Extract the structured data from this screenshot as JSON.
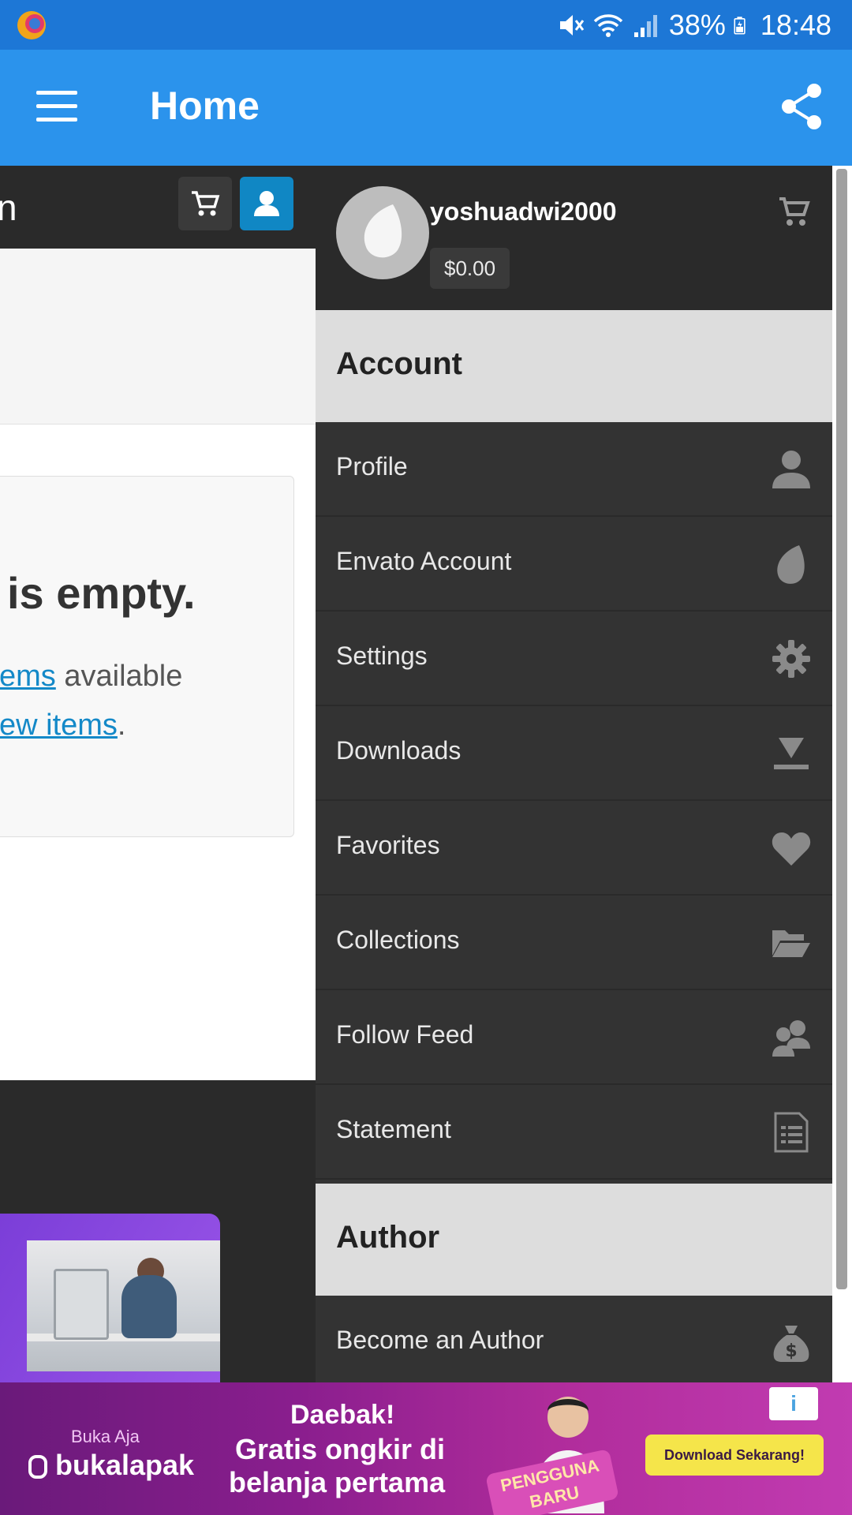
{
  "status_bar": {
    "battery": "38%",
    "time": "18:48",
    "icons": [
      "firefox-focus-icon",
      "mute-icon",
      "wifi-icon",
      "signal-icon",
      "battery-icon"
    ]
  },
  "app_bar": {
    "title": "Home",
    "icons": [
      "menu-icon",
      "share-icon"
    ]
  },
  "background_page": {
    "topbar_text": "n",
    "empty": {
      "heading": "is empty.",
      "line1_link": "ems",
      "line1_rest": " available",
      "line2_link": "ew items",
      "line2_rest": "."
    }
  },
  "drawer": {
    "username": "yoshuadwi2000",
    "balance": "$0.00",
    "sections": {
      "account": "Account",
      "author": "Author"
    },
    "account_items": [
      {
        "label": "Profile",
        "icon": "person-icon"
      },
      {
        "label": "Envato Account",
        "icon": "envato-leaf-icon"
      },
      {
        "label": "Settings",
        "icon": "gear-icon"
      },
      {
        "label": "Downloads",
        "icon": "download-icon"
      },
      {
        "label": "Favorites",
        "icon": "heart-icon"
      },
      {
        "label": "Collections",
        "icon": "folder-open-icon"
      },
      {
        "label": "Follow Feed",
        "icon": "users-icon"
      },
      {
        "label": "Statement",
        "icon": "document-icon"
      }
    ],
    "author_items": [
      {
        "label": "Become an Author",
        "icon": "money-bag-icon"
      }
    ]
  },
  "ad": {
    "brand_small": "Buka Aja",
    "brand": "bukalapak",
    "headline1": "Daebak!",
    "headline2": "Gratis ongkir di",
    "headline3": "belanja pertama",
    "badge": "PENGGUNA BARU",
    "cta": "Download Sekarang!",
    "info": "i"
  },
  "colors": {
    "status_bar": "#1d77d6",
    "app_bar": "#2b93ec",
    "drawer": "#333333",
    "drawer_header": "#2a2a2a",
    "section_header": "#dddddd",
    "link": "#1489c8",
    "user_button": "#1087c4"
  }
}
